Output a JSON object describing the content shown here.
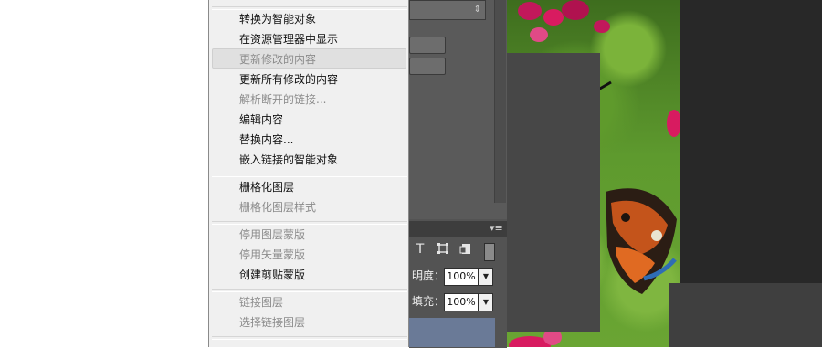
{
  "context_menu": {
    "items": [
      {
        "label": "转换为智能对象",
        "enabled": true
      },
      {
        "label": "在资源管理器中显示",
        "enabled": true
      },
      {
        "label": "更新修改的内容",
        "enabled": false,
        "highlighted": true
      },
      {
        "label": "更新所有修改的内容",
        "enabled": true
      },
      {
        "label": "解析断开的链接...",
        "enabled": false
      },
      {
        "label": "编辑内容",
        "enabled": true
      },
      {
        "label": "替换内容...",
        "enabled": true
      },
      {
        "label": "嵌入链接的智能对象",
        "enabled": true
      },
      {
        "label": "栅格化图层",
        "enabled": true
      },
      {
        "label": "栅格化图层样式",
        "enabled": false
      },
      {
        "label": "停用图层蒙版",
        "enabled": false
      },
      {
        "label": "停用矢量蒙版",
        "enabled": false
      },
      {
        "label": "创建剪贴蒙版",
        "enabled": true
      },
      {
        "label": "链接图层",
        "enabled": false
      },
      {
        "label": "选择链接图层",
        "enabled": false
      }
    ]
  },
  "layers_panel": {
    "opacity_label": "明度：",
    "opacity_value": "100%",
    "fill_label": "填充：",
    "fill_value": "100%",
    "tools": [
      "type-filter-icon",
      "transform-filter-icon",
      "smart-object-filter-icon",
      "filter-toggle-icon"
    ]
  },
  "colors": {
    "menu_bg": "#f0f0f0",
    "menu_text": "#111111",
    "menu_disabled_text": "#8b8b8b",
    "workspace_bg": "#535353",
    "selected_layer": "#6a7a97"
  }
}
